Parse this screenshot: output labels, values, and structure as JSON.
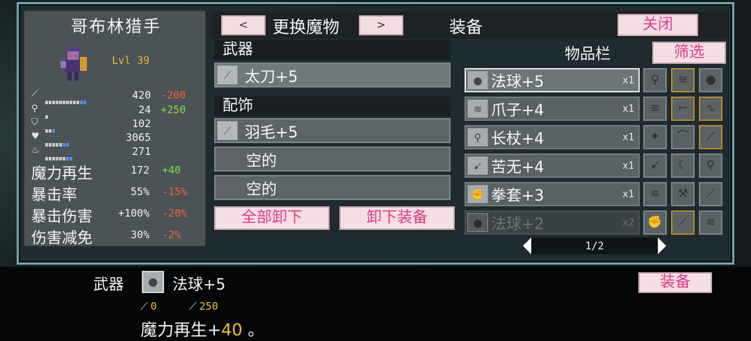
{
  "character": {
    "name": "哥布林猎手",
    "level": "Lvl 39",
    "stats": [
      {
        "icon": "sword-icon",
        "value": "420",
        "delta": "-200",
        "delta_type": "neg",
        "bar_white": 10,
        "bar_blue": 2
      },
      {
        "icon": "staff-icon",
        "value": "24",
        "delta": "+250",
        "delta_type": "pos",
        "bar_white": 1,
        "bar_blue": 0
      },
      {
        "icon": "shield-icon",
        "value": "102",
        "delta": "",
        "delta_type": "",
        "bar_white": 2,
        "bar_blue": 1
      },
      {
        "icon": "heart-icon",
        "value": "3065",
        "delta": "",
        "delta_type": "",
        "bar_white": 5,
        "bar_blue": 2
      },
      {
        "icon": "potion-icon",
        "value": "271",
        "delta": "",
        "delta_type": "",
        "bar_white": 6,
        "bar_blue": 2
      }
    ],
    "big_stats": [
      {
        "label": "魔力再生",
        "value": "172",
        "delta": "+40",
        "delta_type": "pos"
      },
      {
        "label": "暴击率",
        "value": "55%",
        "delta": "-15%",
        "delta_type": "neg"
      },
      {
        "label": "暴击伤害",
        "value": "+100%",
        "delta": "-20%",
        "delta_type": "neg"
      },
      {
        "label": "伤害减免",
        "value": "30%",
        "delta": "-2%",
        "delta_type": "neg"
      }
    ]
  },
  "header": {
    "prev_label": "<",
    "switch_label": "更换魔物",
    "next_label": ">",
    "title": "装备",
    "close_label": "关闭"
  },
  "equipment": {
    "weapon_header": "武器",
    "weapon": {
      "name": "太刀+5",
      "icon": "katana-icon"
    },
    "accessory_header": "配饰",
    "accessories": [
      {
        "name": "羽毛+5",
        "icon": "feather-icon"
      },
      {
        "name": "空的"
      },
      {
        "name": "空的"
      }
    ],
    "unequip_all_label": "全部卸下",
    "unequip_label": "卸下装备"
  },
  "inventory": {
    "title": "物品栏",
    "filter_label": "筛选",
    "items": [
      {
        "name": "法球+5",
        "qty": "x1",
        "icon": "orb-icon",
        "state": "sel"
      },
      {
        "name": "爪子+4",
        "qty": "x1",
        "icon": "claw-icon",
        "state": ""
      },
      {
        "name": "长杖+4",
        "qty": "x1",
        "icon": "staff-icon",
        "state": ""
      },
      {
        "name": "苦无+4",
        "qty": "x1",
        "icon": "kunai-icon",
        "state": ""
      },
      {
        "name": "拳套+3",
        "qty": "x1",
        "icon": "gauntlet-icon",
        "state": ""
      },
      {
        "name": "法球+2",
        "qty": "x2",
        "icon": "orb-icon",
        "state": "dim"
      }
    ],
    "grid": [
      [
        "staff-icon",
        "claw-icon",
        "orb-icon"
      ],
      [
        "claw-icon",
        "scythe-icon",
        "whip-icon"
      ],
      [
        "shuriken-icon",
        "boomerang-icon",
        "sword-icon"
      ],
      [
        "kunai-icon",
        "sickle-icon",
        "staff-icon"
      ],
      [
        "claw-icon",
        "axe-icon",
        "sword-icon"
      ],
      [
        "gauntlet-icon",
        "sword-icon",
        "claw-icon"
      ]
    ],
    "grid_gold": [
      [
        false,
        true,
        false
      ],
      [
        false,
        true,
        true
      ],
      [
        false,
        false,
        true
      ],
      [
        false,
        false,
        false
      ],
      [
        false,
        false,
        false
      ],
      [
        false,
        true,
        false
      ]
    ],
    "page": "1/2"
  },
  "detail": {
    "slot_label": "武器",
    "item_name": "法球+5",
    "stat1": "0",
    "stat2": "250",
    "effect_prefix": "魔力再生+",
    "effect_value": "40",
    "effect_suffix": " 。",
    "equip_label": "装备"
  }
}
